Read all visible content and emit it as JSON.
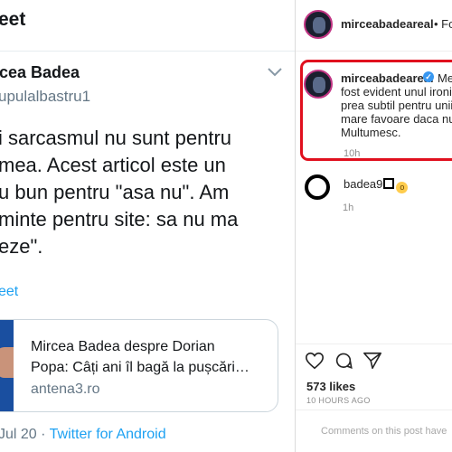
{
  "tweet": {
    "header": "eet",
    "author_name": "rcea Badea",
    "author_handle": "upulalbastru1",
    "body_lines": [
      "i sarcasmul nu sunt pentru",
      "mea. Acest articol este un",
      "u bun pentru \"asa nu\". Am",
      "minte pentru site: sa nu ma",
      "eze\"."
    ],
    "translate": "eet",
    "card": {
      "title_lines": [
        "Mircea Badea despre Dorian",
        "Popa: Câți ani îl bagă la pușcări…"
      ],
      "domain": "antena3.ro"
    },
    "date": "Jul 20",
    "separator": " · ",
    "app": "Twitter for Android"
  },
  "instagram": {
    "username": "mirceabadeareal",
    "follow_fragment": "• Fo",
    "caption": {
      "username": "mirceabadeareal",
      "text_start": "Mes",
      "lines": [
        "fost evident unul ironic.",
        "prea subtil pentru unii. I",
        "mare favoare daca nu m",
        "Multumesc."
      ],
      "time": "10h"
    },
    "comment": {
      "username": "badea9",
      "time": "1h"
    },
    "likes": "573 likes",
    "posted_ago": "10 HOURS AGO",
    "comment_placeholder": "Comments on this post have"
  },
  "colors": {
    "twitter_blue": "#1da1f2",
    "highlight_red": "#e0101e",
    "instagram_text": "#262626"
  }
}
